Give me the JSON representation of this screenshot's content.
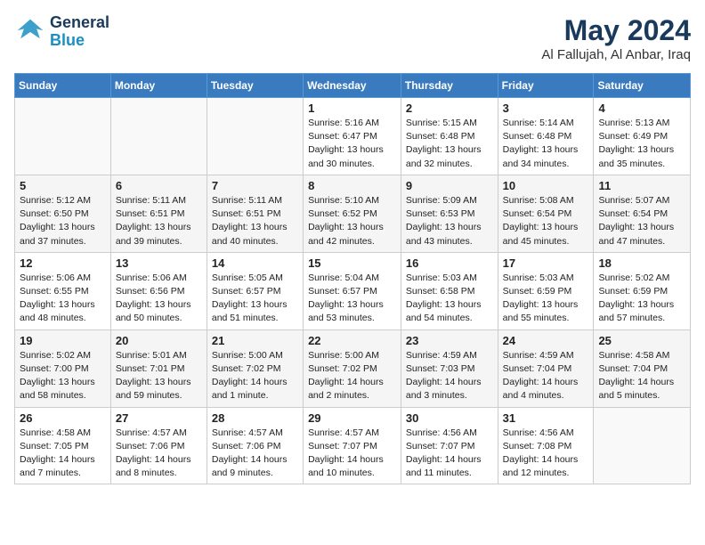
{
  "header": {
    "logo_line1": "General",
    "logo_line2": "Blue",
    "title": "May 2024",
    "subtitle": "Al Fallujah, Al Anbar, Iraq"
  },
  "weekdays": [
    "Sunday",
    "Monday",
    "Tuesday",
    "Wednesday",
    "Thursday",
    "Friday",
    "Saturday"
  ],
  "weeks": [
    [
      {
        "day": "",
        "info": ""
      },
      {
        "day": "",
        "info": ""
      },
      {
        "day": "",
        "info": ""
      },
      {
        "day": "1",
        "info": "Sunrise: 5:16 AM\nSunset: 6:47 PM\nDaylight: 13 hours\nand 30 minutes."
      },
      {
        "day": "2",
        "info": "Sunrise: 5:15 AM\nSunset: 6:48 PM\nDaylight: 13 hours\nand 32 minutes."
      },
      {
        "day": "3",
        "info": "Sunrise: 5:14 AM\nSunset: 6:48 PM\nDaylight: 13 hours\nand 34 minutes."
      },
      {
        "day": "4",
        "info": "Sunrise: 5:13 AM\nSunset: 6:49 PM\nDaylight: 13 hours\nand 35 minutes."
      }
    ],
    [
      {
        "day": "5",
        "info": "Sunrise: 5:12 AM\nSunset: 6:50 PM\nDaylight: 13 hours\nand 37 minutes."
      },
      {
        "day": "6",
        "info": "Sunrise: 5:11 AM\nSunset: 6:51 PM\nDaylight: 13 hours\nand 39 minutes."
      },
      {
        "day": "7",
        "info": "Sunrise: 5:11 AM\nSunset: 6:51 PM\nDaylight: 13 hours\nand 40 minutes."
      },
      {
        "day": "8",
        "info": "Sunrise: 5:10 AM\nSunset: 6:52 PM\nDaylight: 13 hours\nand 42 minutes."
      },
      {
        "day": "9",
        "info": "Sunrise: 5:09 AM\nSunset: 6:53 PM\nDaylight: 13 hours\nand 43 minutes."
      },
      {
        "day": "10",
        "info": "Sunrise: 5:08 AM\nSunset: 6:54 PM\nDaylight: 13 hours\nand 45 minutes."
      },
      {
        "day": "11",
        "info": "Sunrise: 5:07 AM\nSunset: 6:54 PM\nDaylight: 13 hours\nand 47 minutes."
      }
    ],
    [
      {
        "day": "12",
        "info": "Sunrise: 5:06 AM\nSunset: 6:55 PM\nDaylight: 13 hours\nand 48 minutes."
      },
      {
        "day": "13",
        "info": "Sunrise: 5:06 AM\nSunset: 6:56 PM\nDaylight: 13 hours\nand 50 minutes."
      },
      {
        "day": "14",
        "info": "Sunrise: 5:05 AM\nSunset: 6:57 PM\nDaylight: 13 hours\nand 51 minutes."
      },
      {
        "day": "15",
        "info": "Sunrise: 5:04 AM\nSunset: 6:57 PM\nDaylight: 13 hours\nand 53 minutes."
      },
      {
        "day": "16",
        "info": "Sunrise: 5:03 AM\nSunset: 6:58 PM\nDaylight: 13 hours\nand 54 minutes."
      },
      {
        "day": "17",
        "info": "Sunrise: 5:03 AM\nSunset: 6:59 PM\nDaylight: 13 hours\nand 55 minutes."
      },
      {
        "day": "18",
        "info": "Sunrise: 5:02 AM\nSunset: 6:59 PM\nDaylight: 13 hours\nand 57 minutes."
      }
    ],
    [
      {
        "day": "19",
        "info": "Sunrise: 5:02 AM\nSunset: 7:00 PM\nDaylight: 13 hours\nand 58 minutes."
      },
      {
        "day": "20",
        "info": "Sunrise: 5:01 AM\nSunset: 7:01 PM\nDaylight: 13 hours\nand 59 minutes."
      },
      {
        "day": "21",
        "info": "Sunrise: 5:00 AM\nSunset: 7:02 PM\nDaylight: 14 hours\nand 1 minute."
      },
      {
        "day": "22",
        "info": "Sunrise: 5:00 AM\nSunset: 7:02 PM\nDaylight: 14 hours\nand 2 minutes."
      },
      {
        "day": "23",
        "info": "Sunrise: 4:59 AM\nSunset: 7:03 PM\nDaylight: 14 hours\nand 3 minutes."
      },
      {
        "day": "24",
        "info": "Sunrise: 4:59 AM\nSunset: 7:04 PM\nDaylight: 14 hours\nand 4 minutes."
      },
      {
        "day": "25",
        "info": "Sunrise: 4:58 AM\nSunset: 7:04 PM\nDaylight: 14 hours\nand 5 minutes."
      }
    ],
    [
      {
        "day": "26",
        "info": "Sunrise: 4:58 AM\nSunset: 7:05 PM\nDaylight: 14 hours\nand 7 minutes."
      },
      {
        "day": "27",
        "info": "Sunrise: 4:57 AM\nSunset: 7:06 PM\nDaylight: 14 hours\nand 8 minutes."
      },
      {
        "day": "28",
        "info": "Sunrise: 4:57 AM\nSunset: 7:06 PM\nDaylight: 14 hours\nand 9 minutes."
      },
      {
        "day": "29",
        "info": "Sunrise: 4:57 AM\nSunset: 7:07 PM\nDaylight: 14 hours\nand 10 minutes."
      },
      {
        "day": "30",
        "info": "Sunrise: 4:56 AM\nSunset: 7:07 PM\nDaylight: 14 hours\nand 11 minutes."
      },
      {
        "day": "31",
        "info": "Sunrise: 4:56 AM\nSunset: 7:08 PM\nDaylight: 14 hours\nand 12 minutes."
      },
      {
        "day": "",
        "info": ""
      }
    ]
  ]
}
